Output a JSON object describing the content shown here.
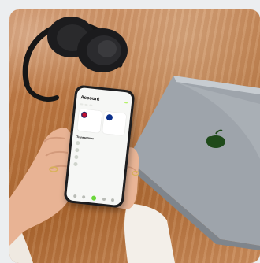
{
  "scene": {
    "description_objects": [
      "headphones-icon",
      "smartphone",
      "laptop",
      "hands"
    ],
    "colors": {
      "table": "#b9763f",
      "laptop": "#9aa0a8",
      "phone_frame": "#1d1d1f",
      "accent_green": "#b6f26b",
      "apple_logo": "#1f4a1a",
      "sweater": "#f3efe9",
      "skin": "#e8b394"
    }
  },
  "phone": {
    "title": "Account",
    "badge": "",
    "pills": [
      "",
      "",
      ""
    ],
    "accounts": [
      {
        "flag": "uk",
        "amount": "",
        "sub": ""
      },
      {
        "flag": "eu",
        "amount": "",
        "sub": ""
      }
    ],
    "transactions_title": "Transactions",
    "transactions": [
      {
        "name": "",
        "amount": ""
      },
      {
        "name": "",
        "amount": ""
      },
      {
        "name": "",
        "amount": ""
      },
      {
        "name": "",
        "amount": ""
      }
    ]
  }
}
